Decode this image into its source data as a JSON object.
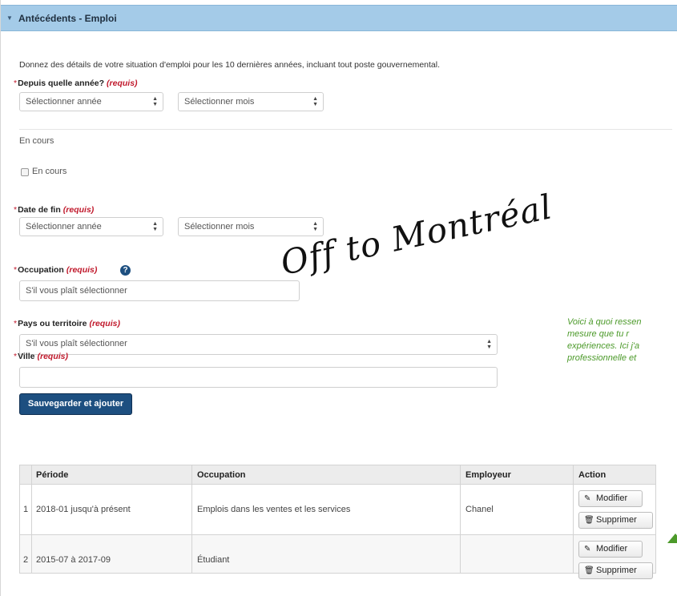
{
  "section": {
    "title": "Antécédents - Emploi"
  },
  "intro": "Donnez des détails de votre situation d'emploi pour les 10 dernières années, incluant tout poste gouvernemental.",
  "since": {
    "label": "Depuis quelle année?",
    "required": "(requis)",
    "year_value": "Sélectionner année",
    "month_value": "Sélectionner mois"
  },
  "ongoing": {
    "label": "En cours",
    "checkbox_label": "En cours"
  },
  "end_date": {
    "label": "Date de fin",
    "required": "(requis)",
    "year_value": "Sélectionner année",
    "month_value": "Sélectionner mois"
  },
  "occupation": {
    "label": "Occupation",
    "required": "(requis)",
    "value": "S'il vous plaît sélectionner"
  },
  "country": {
    "label": "Pays ou territoire",
    "required": "(requis)",
    "value": "S'il vous plaît sélectionner"
  },
  "city": {
    "label": "Ville",
    "required": "(requis)",
    "value": ""
  },
  "save_button": "Sauvegarder et ajouter",
  "table": {
    "headers": [
      "Période",
      "Occupation",
      "Employeur",
      "Action"
    ],
    "rows": [
      {
        "index": "1",
        "period": "2018-01 jusqu'à présent",
        "occupation": "Emplois dans les ventes et les services",
        "employer": "Chanel",
        "edit": "Modifier",
        "delete": "Supprimer"
      },
      {
        "index": "2",
        "period": "2015-07 à 2017-09",
        "occupation": "Étudiant",
        "employer": "",
        "edit": "Modifier",
        "delete": "Supprimer"
      }
    ]
  },
  "overlay_text": "Off to Montréal",
  "note_lines": [
    "Voici à quoi ressen",
    "mesure que tu r",
    "expériences. Ici j'a",
    "professionnelle et"
  ],
  "icons": {
    "caret": "caret-down-icon",
    "help": "question-circle-icon",
    "edit": "pencil-icon",
    "delete": "trash-icon"
  },
  "colors": {
    "header": "#a4cbe8",
    "primary_button": "#1d4f80",
    "required": "#c0182b",
    "note": "#4c9a2a"
  }
}
